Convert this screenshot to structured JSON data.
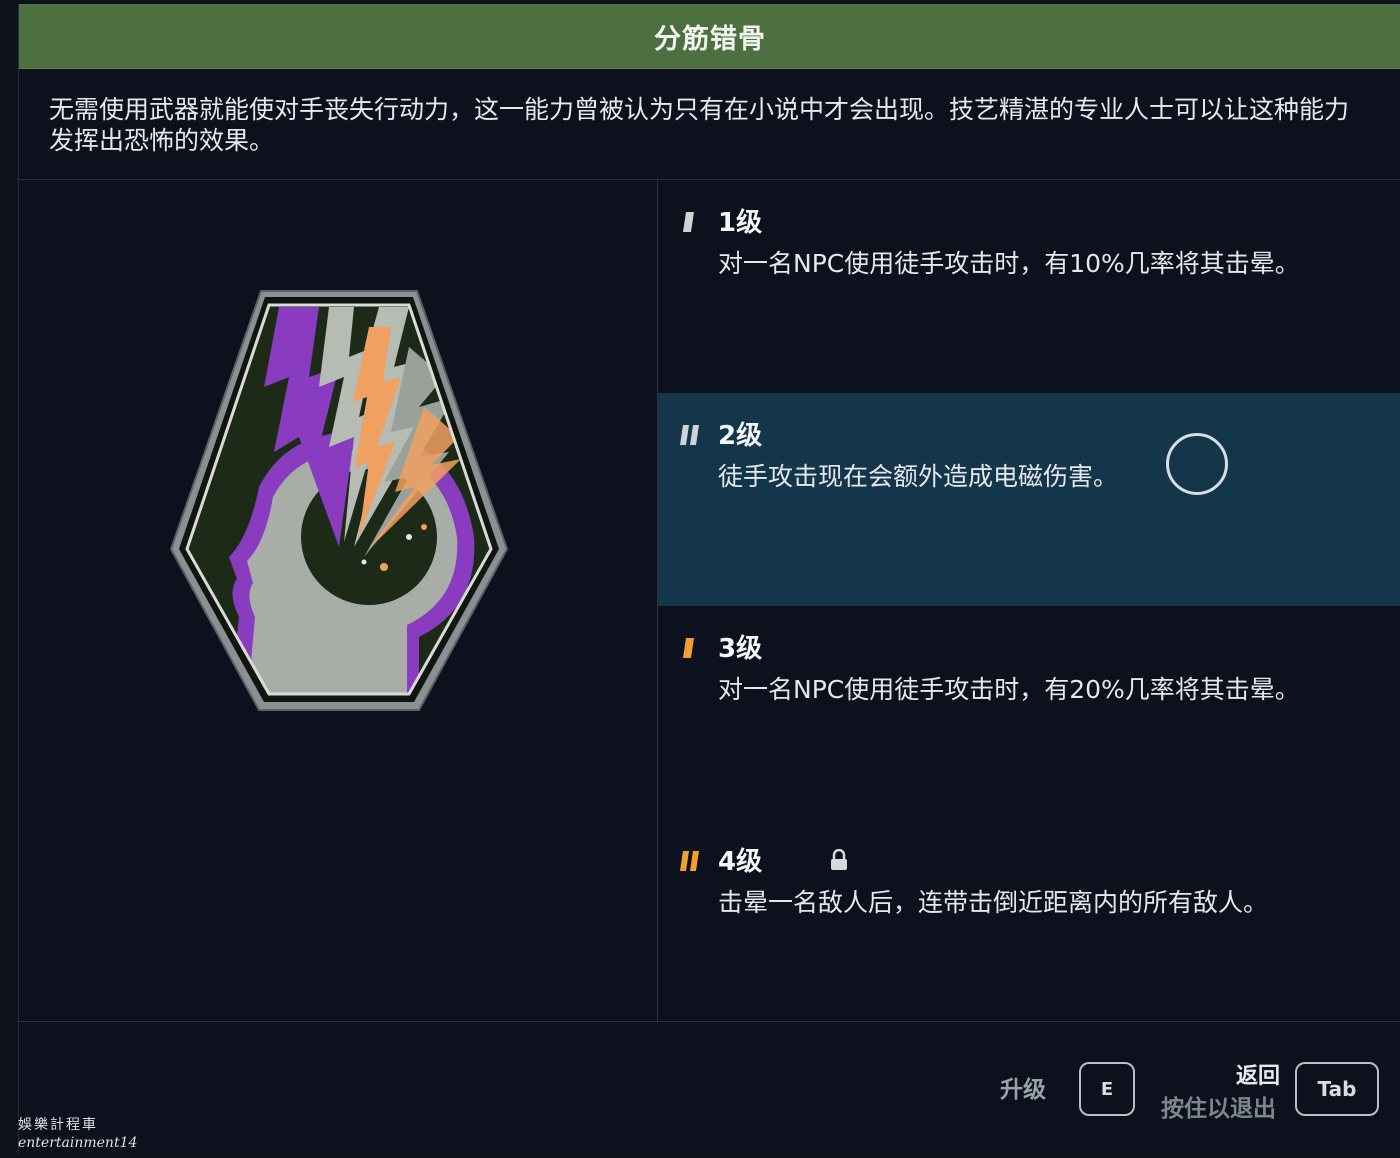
{
  "skill": {
    "title": "分筋错骨",
    "description": "无需使用武器就能使对手丧失行动力，这一能力曾被认为只有在小说中才会出现。技艺精湛的专业人士可以让这种能力发挥出恐怖的效果。",
    "icon": "mind-lightning-badge-icon"
  },
  "levels": [
    {
      "title": "1级",
      "description": "对一名NPC使用徒手攻击时，有10%几率将其击晕。",
      "state": "unlocked",
      "bars": 1,
      "bar_color": "#cfd3d6"
    },
    {
      "title": "2级",
      "description": "徒手攻击现在会额外造成电磁伤害。",
      "state": "selected",
      "bars": 2,
      "bar_color": "#cfd3d6"
    },
    {
      "title": "3级",
      "description": "对一名NPC使用徒手攻击时，有20%几率将其击晕。",
      "state": "available",
      "bars": 1,
      "bar_color": "#f0a030"
    },
    {
      "title": "4级",
      "description": "击晕一名敌人后，连带击倒近距离内的所有敌人。",
      "state": "locked",
      "bars": 2,
      "bar_color": "#f0a030"
    }
  ],
  "footer": {
    "upgrade_label": "升级",
    "upgrade_key": "E",
    "back_label": "返回",
    "hold_label": "按住以退出",
    "back_key": "Tab"
  },
  "watermark": {
    "line1": "娛樂計程車",
    "line2": "entertainment14"
  },
  "colors": {
    "title_bar": "#4c7040",
    "panel_bg": "#0c111d",
    "selected_row": "#14364a",
    "accent_orange": "#f0a030",
    "badge_purple": "#8a3cc0"
  }
}
